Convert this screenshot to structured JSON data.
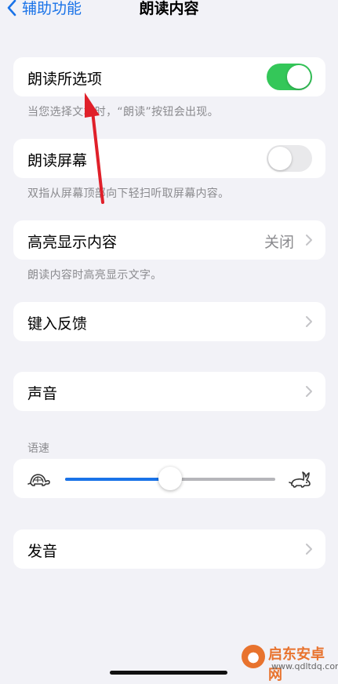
{
  "nav": {
    "back_label": "辅助功能",
    "title": "朗读内容"
  },
  "speak_selection": {
    "label": "朗读所选项",
    "enabled": true,
    "footer": "当您选择文本时，“朗读”按钮会出现。"
  },
  "speak_screen": {
    "label": "朗读屏幕",
    "enabled": false,
    "footer": "双指从屏幕顶部向下轻扫听取屏幕内容。"
  },
  "highlight": {
    "label": "高亮显示内容",
    "value": "关闭",
    "footer": "朗读内容时高亮显示文字。"
  },
  "typing_feedback": {
    "label": "键入反馈"
  },
  "voices": {
    "label": "声音"
  },
  "speaking_rate": {
    "header": "语速",
    "value": 0.5,
    "slow_icon": "turtle-icon",
    "fast_icon": "rabbit-icon"
  },
  "pronunciations": {
    "label": "发音"
  },
  "colors": {
    "accent": "#1a73e8",
    "toggle_on": "#34c759",
    "background": "#f2f2f7",
    "annotation_arrow": "#e0202a"
  },
  "watermark": {
    "title": "启东安卓网",
    "url": "www.qdltdq.com"
  }
}
